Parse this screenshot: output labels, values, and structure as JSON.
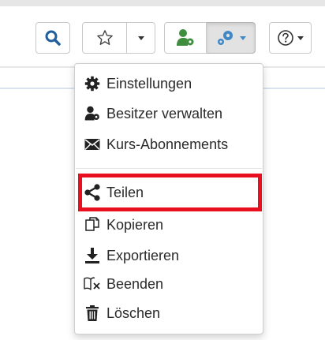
{
  "toolbar": {
    "search_icon": "search-icon",
    "favorite_icon": "star-outline-icon",
    "owners_icon": "user-gear-icon",
    "tools_icon": "gears-icon",
    "help_icon": "question-circle-icon"
  },
  "menu": {
    "items": [
      {
        "label": "Einstellungen",
        "icon": "gear-icon"
      },
      {
        "label": "Besitzer verwalten",
        "icon": "user-gear-icon"
      },
      {
        "label": "Kurs-Abonnements",
        "icon": "envelope-icon"
      },
      {
        "label": "Teilen",
        "icon": "share-icon"
      },
      {
        "label": "Kopieren",
        "icon": "copy-icon"
      },
      {
        "label": "Exportieren",
        "icon": "download-icon"
      },
      {
        "label": "Beenden",
        "icon": "book-close-icon"
      },
      {
        "label": "Löschen",
        "icon": "trash-icon"
      }
    ],
    "highlighted_item": "Teilen"
  },
  "colors": {
    "accent_blue": "#3f88c5",
    "owner_green": "#3f8e3f",
    "highlight_red": "#e8101e"
  }
}
